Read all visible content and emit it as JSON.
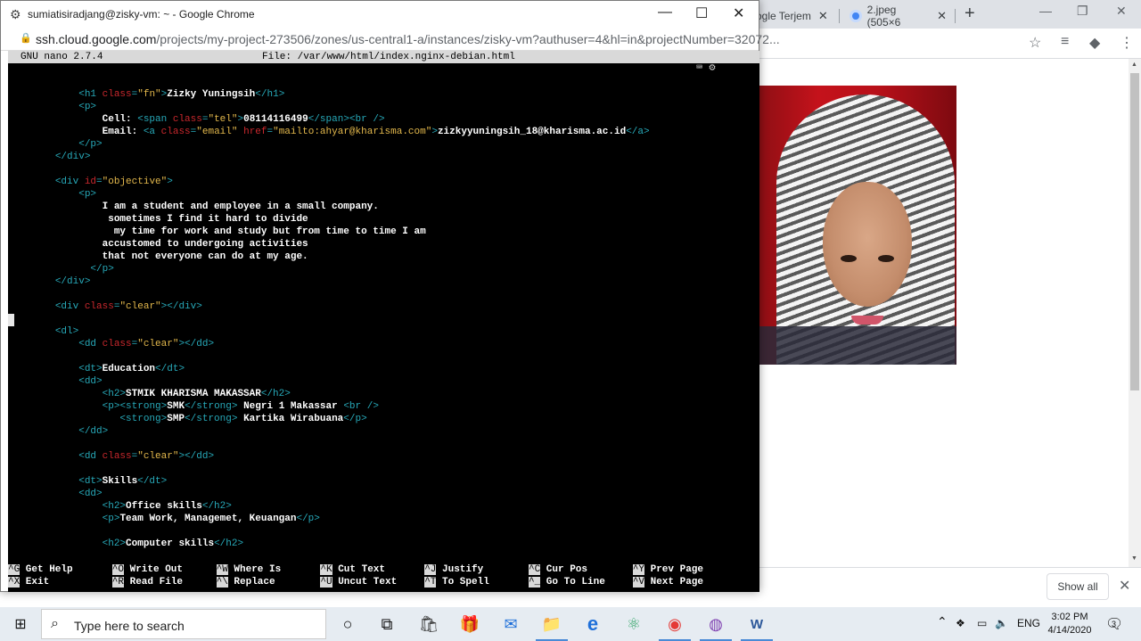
{
  "background_browser": {
    "tabs": [
      {
        "label": "ogle Terjem"
      },
      {
        "label": "2.jpeg (505×6"
      }
    ],
    "close_glyph": "✕",
    "new_tab_glyph": "+",
    "window_controls": {
      "minimize": "—",
      "restore": "❐",
      "close": "✕"
    },
    "toolbar_icons": {
      "star": "☆",
      "reading_list": "≡",
      "extension": "◆",
      "menu": "⋮"
    },
    "image_alt": "photo of a person wearing a striped hijab",
    "download_bar": {
      "show_all_label": "Show all",
      "close_glyph": "✕"
    }
  },
  "ssh_window": {
    "title": "sumiatisiradjang@zisky-vm: ~ - Google Chrome",
    "controls": {
      "minimize": "—",
      "maximize": "☐",
      "close": "✕"
    },
    "url_host": "ssh.cloud.google.com",
    "url_path": "/projects/my-project-273506/zones/us-central1-a/instances/zisky-vm?authuser=4&hl=in&projectNumber=32072..."
  },
  "nano": {
    "version": "GNU nano 2.7.4",
    "file": "File: /var/www/html/index.nginx-debian.html",
    "lines": [
      "            <h1 class=\"fn\">Zizky Yuningsih</h1>",
      "            <p>",
      "                Cell: <span class=\"tel\">08114116499</span><br />",
      "                Email: <a class=\"email\" href=\"mailto:ahyar@kharisma.com\">zizkyyuningsih_18@kharisma.ac.id</a>",
      "            </p>",
      "        </div>",
      "",
      "        <div id=\"objective\">",
      "            <p>",
      "                I am a student and employee in a small company.",
      "                 sometimes I find it hard to divide",
      "                  my time for work and study but from time to time I am",
      "                accustomed to undergoing activities",
      "                that not everyone can do at my age.",
      "              </p>",
      "        </div>",
      "",
      "        <div class=\"clear\"></div>",
      "",
      "        <dl>",
      "            <dd class=\"clear\"></dd>",
      "",
      "            <dt>Education</dt>",
      "            <dd>",
      "                <h2>STMIK KHARISMA MAKASSAR</h2>",
      "                <p><strong>SMK</strong> Negri 1 Makassar <br />",
      "                   <strong>SMP</strong> Kartika Wirabuana</p>",
      "            </dd>",
      "",
      "            <dd class=\"clear\"></dd>",
      "",
      "            <dt>Skills</dt>",
      "            <dd>",
      "                <h2>Office skills</h2>",
      "                <p>Team Work, Managemet, Keuangan</p>",
      "",
      "                <h2>Computer skills</h2>"
    ],
    "shortcuts_row1": [
      {
        "key": "^G",
        "label": "Get Help"
      },
      {
        "key": "^O",
        "label": "Write Out"
      },
      {
        "key": "^W",
        "label": "Where Is"
      },
      {
        "key": "^K",
        "label": "Cut Text"
      },
      {
        "key": "^J",
        "label": "Justify"
      },
      {
        "key": "^C",
        "label": "Cur Pos"
      },
      {
        "key": "^Y",
        "label": "Prev Page"
      }
    ],
    "shortcuts_row2": [
      {
        "key": "^X",
        "label": "Exit"
      },
      {
        "key": "^R",
        "label": "Read File"
      },
      {
        "key": "^\\",
        "label": "Replace"
      },
      {
        "key": "^U",
        "label": "Uncut Text"
      },
      {
        "key": "^T",
        "label": "To Spell"
      },
      {
        "key": "^_",
        "label": "Go To Line"
      },
      {
        "key": "^V",
        "label": "Next Page"
      }
    ],
    "terminal_icons": "⌨ ⚙"
  },
  "taskbar": {
    "start_glyph": "⊞",
    "search_placeholder": "Type here to search",
    "search_glyph": "⌕",
    "apps": [
      {
        "name": "cortana-icon",
        "glyph": "○",
        "color": "#111111"
      },
      {
        "name": "task-view-icon",
        "glyph": "⧉",
        "color": "#111111"
      },
      {
        "name": "store-icon",
        "glyph": "🛍",
        "color": "#333333"
      },
      {
        "name": "gift-app-icon",
        "glyph": "🎁",
        "color": "#c62828"
      },
      {
        "name": "mail-icon",
        "glyph": "✉",
        "color": "#1e6fd9"
      },
      {
        "name": "file-explorer-icon",
        "glyph": "📁",
        "color": "#e0a800"
      },
      {
        "name": "edge-icon",
        "glyph": "e",
        "color": "#1e6fd9"
      },
      {
        "name": "atom-app-icon",
        "glyph": "⚛",
        "color": "#3aa76d"
      },
      {
        "name": "chrome-icon",
        "glyph": "◉",
        "color": "#e53935"
      },
      {
        "name": "media-app-icon",
        "glyph": "◍",
        "color": "#7e3fb0"
      },
      {
        "name": "word-icon",
        "glyph": "W",
        "color": "#2b579a"
      }
    ],
    "tray": {
      "chevron": "⌃",
      "dropbox": "❖",
      "battery": "▭",
      "volume": "🔈",
      "lang": "ENG"
    },
    "time": "3:02 PM",
    "date": "4/14/2020",
    "notification_glyph": "🗨",
    "notification_count": "3"
  }
}
